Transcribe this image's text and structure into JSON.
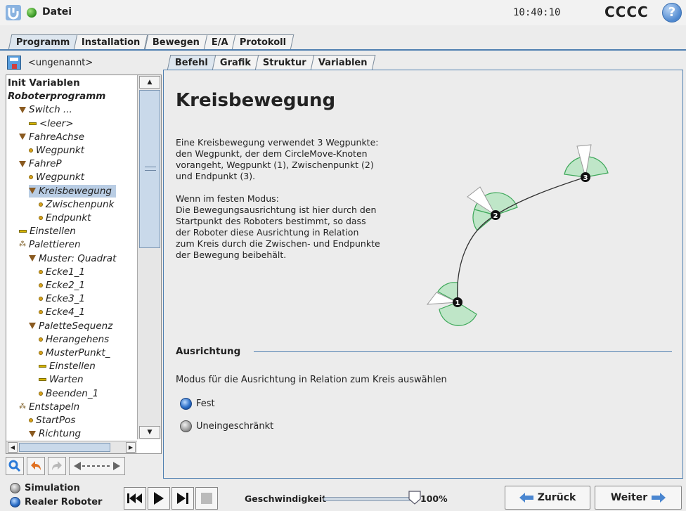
{
  "header": {
    "file_label": "Datei",
    "clock": "10:40:10",
    "robot_name": "CCCC",
    "help": "?"
  },
  "main_tabs": [
    {
      "label": "Programm",
      "active": true
    },
    {
      "label": "Installation",
      "active": false
    },
    {
      "label": "Bewegen",
      "active": false
    },
    {
      "label": "E/A",
      "active": false
    },
    {
      "label": "Protokoll",
      "active": false
    }
  ],
  "program": {
    "name": "<ungenannt>"
  },
  "tree": [
    {
      "label": "Init Variablen",
      "style": "bold",
      "indent": 0,
      "icon": "none"
    },
    {
      "label": "Roboterprogramm",
      "style": "bolditalic",
      "indent": 0,
      "icon": "collapse"
    },
    {
      "label": "Switch ...",
      "style": "italic",
      "indent": 1,
      "icon": "tri"
    },
    {
      "label": "<leer>",
      "style": "italic",
      "indent": 2,
      "icon": "bar"
    },
    {
      "label": "FahreAchse",
      "style": "italic",
      "indent": 1,
      "icon": "tri"
    },
    {
      "label": "Wegpunkt",
      "style": "italic",
      "indent": 2,
      "icon": "dot"
    },
    {
      "label": "FahreP",
      "style": "italic",
      "indent": 1,
      "icon": "tri"
    },
    {
      "label": "Wegpunkt",
      "style": "italic",
      "indent": 2,
      "icon": "dot"
    },
    {
      "label": "Kreisbewegung",
      "style": "italic selected",
      "indent": 2,
      "icon": "tri"
    },
    {
      "label": "Zwischenpunk",
      "style": "italic",
      "indent": 3,
      "icon": "dot"
    },
    {
      "label": "Endpunkt",
      "style": "italic",
      "indent": 3,
      "icon": "dot"
    },
    {
      "label": "Einstellen",
      "style": "italic",
      "indent": 1,
      "icon": "bar"
    },
    {
      "label": "Palettieren",
      "style": "italic",
      "indent": 1,
      "icon": "pal"
    },
    {
      "label": "Muster: Quadrat",
      "style": "italic",
      "indent": 2,
      "icon": "tri"
    },
    {
      "label": "Ecke1_1",
      "style": "italic",
      "indent": 3,
      "icon": "dot"
    },
    {
      "label": "Ecke2_1",
      "style": "italic",
      "indent": 3,
      "icon": "dot"
    },
    {
      "label": "Ecke3_1",
      "style": "italic",
      "indent": 3,
      "icon": "dot"
    },
    {
      "label": "Ecke4_1",
      "style": "italic",
      "indent": 3,
      "icon": "dot"
    },
    {
      "label": "PaletteSequenz",
      "style": "italic",
      "indent": 2,
      "icon": "tri"
    },
    {
      "label": "Herangehens",
      "style": "italic",
      "indent": 3,
      "icon": "dot"
    },
    {
      "label": "MusterPunkt_",
      "style": "italic",
      "indent": 3,
      "icon": "dot"
    },
    {
      "label": "Einstellen",
      "style": "italic",
      "indent": 3,
      "icon": "bar"
    },
    {
      "label": "Warten",
      "style": "italic",
      "indent": 3,
      "icon": "bar"
    },
    {
      "label": "Beenden_1",
      "style": "italic",
      "indent": 3,
      "icon": "dot"
    },
    {
      "label": "Entstapeln",
      "style": "italic",
      "indent": 1,
      "icon": "pal"
    },
    {
      "label": "StartPos",
      "style": "italic",
      "indent": 2,
      "icon": "dot"
    },
    {
      "label": "Richtung",
      "style": "italic",
      "indent": 2,
      "icon": "tri"
    }
  ],
  "sub_tabs": [
    {
      "label": "Befehl",
      "active": true
    },
    {
      "label": "Grafik",
      "active": false
    },
    {
      "label": "Struktur",
      "active": false
    },
    {
      "label": "Variablen",
      "active": false
    }
  ],
  "content": {
    "title": "Kreisbewegung",
    "description": "Eine Kreisbewegung verwendet 3 Wegpunkte:\nden Wegpunkt, der dem CircleMove-Knoten\nvorangeht, Wegpunkt (1), Zwischenpunkt (2)\nund Endpunkt (3).\n\nWenn im festen Modus:\nDie Bewegungsausrichtung ist hier durch den\nStartpunkt des Roboters bestimmt, so dass\nder Roboter diese Ausrichtung in Relation\nzum Kreis durch die Zwischen- und Endpunkte\nder Bewegung beibehält.",
    "diagram_points": [
      "1",
      "2",
      "3"
    ],
    "section_title": "Ausrichtung",
    "mode_text": "Modus für die Ausrichtung in Relation zum Kreis auswählen",
    "options": [
      {
        "label": "Fest",
        "selected": true
      },
      {
        "label": "Uneingeschränkt",
        "selected": false
      }
    ]
  },
  "bottom": {
    "simulation_label": "Simulation",
    "real_robot_label": "Realer Roboter",
    "speed_label": "Geschwindigkeit",
    "speed_value": "100%",
    "speed_fraction": 1.0,
    "back_label": "Zurück",
    "next_label": "Weiter"
  },
  "colors": {
    "accent": "#4f7fb0",
    "selected_row": "#b9cde4",
    "arc_sector": "#bfe6c8"
  }
}
